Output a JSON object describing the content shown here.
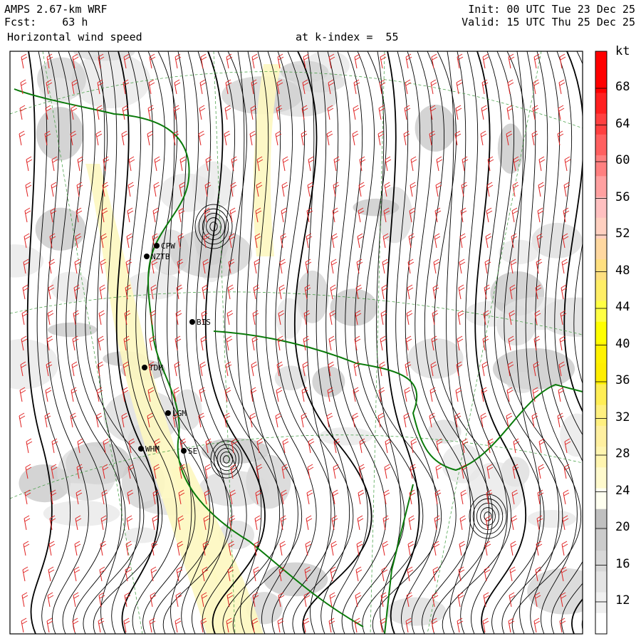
{
  "header": {
    "model": "AMPS 2.67-km WRF",
    "forecast": "Fcst:    63 h",
    "init": "Init: 00 UTC Tue 23 Dec 25",
    "valid": "Valid: 15 UTC Thu 25 Dec 25",
    "field": "Horizontal wind speed",
    "level": "at k-index =  55"
  },
  "colorbar": {
    "unit": "kt",
    "labels": [
      "68",
      "64",
      "60",
      "56",
      "52",
      "48",
      "44",
      "40",
      "36",
      "32",
      "28",
      "24",
      "20",
      "16",
      "12"
    ],
    "colors": [
      "#ffffff",
      "#f0f0f0",
      "#e4e4e4",
      "#d8d8d8",
      "#cccccc",
      "#c0c0c0",
      "#fffff0",
      "#fffacd",
      "#fff5b0",
      "#fff0a0",
      "#fff080",
      "#ffee55",
      "#ffee00",
      "#fff200",
      "#ffff00",
      "#ffff44",
      "#ffee66",
      "#ffe080",
      "#ffd8a0",
      "#ffd0c0",
      "#ffc0c0",
      "#ffa0a0",
      "#ff8080",
      "#ff6060",
      "#ff4040",
      "#ff2020",
      "#ff0000",
      "#ff0000"
    ]
  },
  "stations": [
    {
      "code": "CPW"
    },
    {
      "code": "NZTB"
    },
    {
      "code": "BIS"
    },
    {
      "code": "TDM"
    },
    {
      "code": "LGM"
    },
    {
      "code": "WHM"
    },
    {
      "code": "SE"
    }
  ]
}
